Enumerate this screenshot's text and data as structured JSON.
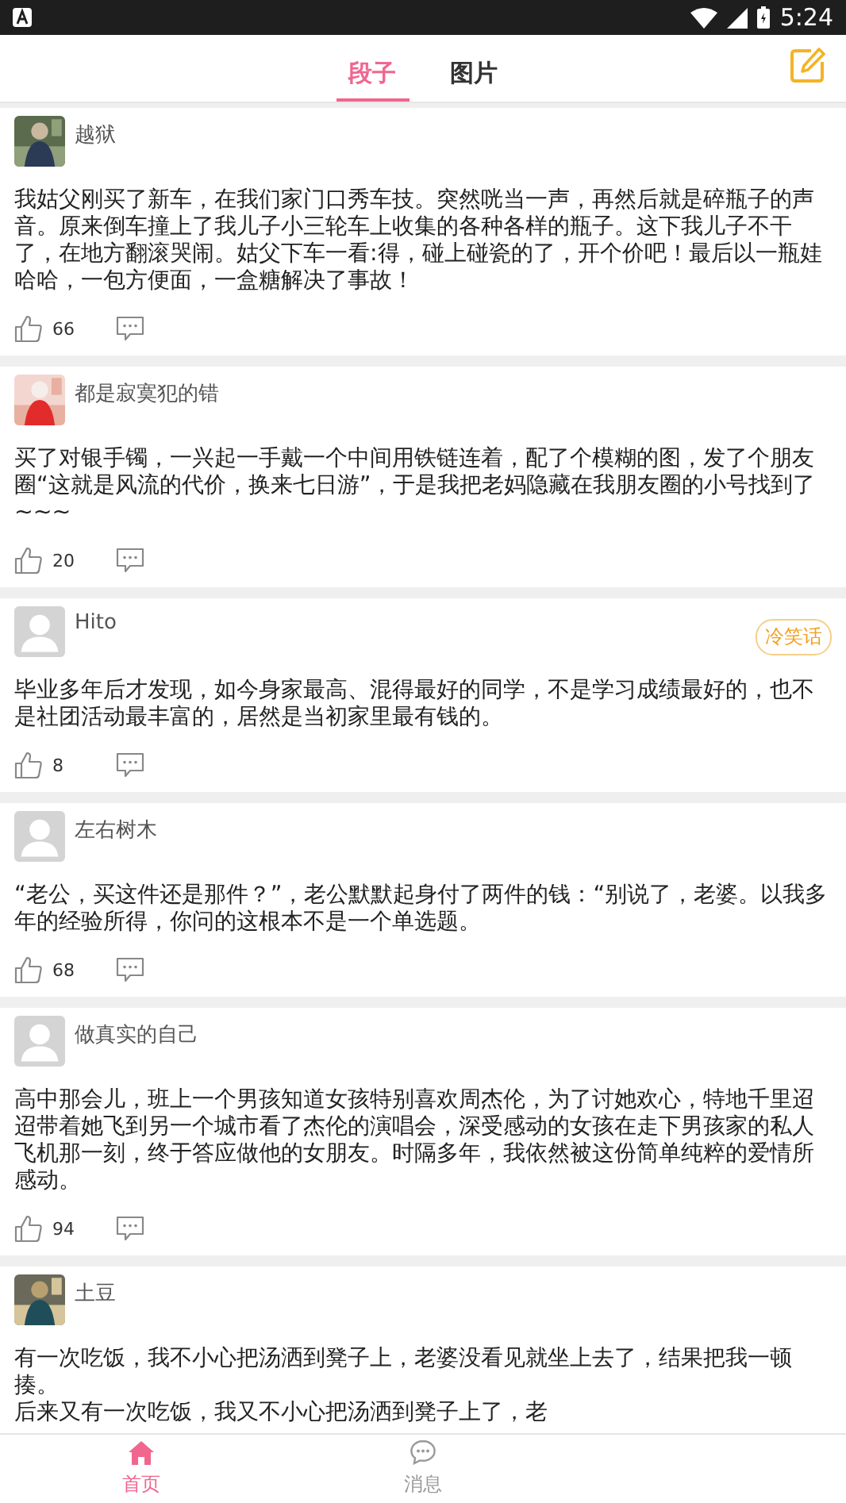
{
  "status_bar": {
    "time": "5:24"
  },
  "tabs": [
    {
      "label": "段子",
      "selected": true
    },
    {
      "label": "图片",
      "selected": false
    }
  ],
  "posts": [
    {
      "author": "越狱",
      "text": "我姑父刚买了新车，在我们家门口秀车技。突然咣当一声，再然后就是碎瓶子的声音。原来倒车撞上了我儿子小三轮车上收集的各种各样的瓶子。这下我儿子不干了，在地方翻滚哭闹。姑父下车一看:得，碰上碰瓷的了，开个价吧！最后以一瓶娃哈哈，一包方便面，一盒糖解决了事故！",
      "likes": "66"
    },
    {
      "author": "都是寂寞犯的错",
      "text": "买了对银手镯，一兴起一手戴一个中间用铁链连着，配了个模糊的图，发了个朋友圈“这就是风流的代价，换来七日游”，于是我把老妈隐藏在我朋友圈的小号找到了~~~",
      "likes": "20"
    },
    {
      "author": "Hito",
      "kind": "default",
      "tag": "冷笑话",
      "text": "毕业多年后才发现，如今身家最高、混得最好的同学，不是学习成绩最好的，也不是社团活动最丰富的，居然是当初家里最有钱的。",
      "likes": "8"
    },
    {
      "author": "左右树木",
      "kind": "default",
      "text": "“老公，买这件还是那件？”，老公默默起身付了两件的钱：“别说了，老婆。以我多年的经验所得，你问的这根本不是一个单选题。",
      "likes": "68"
    },
    {
      "author": "做真实的自己",
      "kind": "default",
      "text": "高中那会儿，班上一个男孩知道女孩特别喜欢周杰伦，为了讨她欢心，特地千里迢迢带着她飞到另一个城市看了杰伦的演唱会，深受感动的女孩在走下男孩家的私人飞机那一刻，终于答应做他的女朋友。时隔多年，我依然被这份简单纯粹的爱情所感动。",
      "likes": "94"
    },
    {
      "author": "土豆",
      "paragraphs": [
        "有一次吃饭，我不小心把汤洒到凳子上，老婆没看见就坐上去了，结果把我一顿揍。",
        "后来又有一次吃饭，我又不小心把汤洒到凳子上了，老"
      ]
    }
  ],
  "bottom_nav": [
    {
      "label": "首页",
      "selected": true
    },
    {
      "label": "消息",
      "selected": false
    }
  ]
}
